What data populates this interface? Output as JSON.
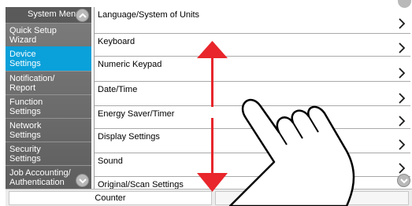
{
  "sidebar": {
    "title": "System Menu",
    "items": [
      {
        "line1": "Quick Setup",
        "line2": "Wizard",
        "selected": false
      },
      {
        "line1": "Device",
        "line2": "Settings",
        "selected": true
      },
      {
        "line1": "Notification/",
        "line2": "Report",
        "selected": false
      },
      {
        "line1": "Function",
        "line2": "Settings",
        "selected": false
      },
      {
        "line1": "Network",
        "line2": "Settings",
        "selected": false
      },
      {
        "line1": "Security",
        "line2": "Settings",
        "selected": false
      },
      {
        "line1": "Job Accounting/",
        "line2": "Authentication",
        "selected": false
      }
    ]
  },
  "settings_list": {
    "items": [
      {
        "label": "Language/System of Units"
      },
      {
        "label": "Keyboard"
      },
      {
        "label": "Numeric Keypad"
      },
      {
        "label": "Date/Time"
      },
      {
        "label": "Energy Saver/Timer"
      },
      {
        "label": "Display Settings"
      },
      {
        "label": "Sound"
      },
      {
        "label": "Original/Scan Settings"
      }
    ]
  },
  "bottom_bar": {
    "counter_label": "Counter"
  },
  "colors": {
    "selected_item": "#0aa0da",
    "sidebar_bg": "#6e6e6e",
    "scroll_arrow": "#e8262b"
  },
  "icons": [
    "chevron-up-icon",
    "chevron-down-icon",
    "chevron-right-icon",
    "scroll-arrow-icon",
    "swipe-hand-icon"
  ]
}
